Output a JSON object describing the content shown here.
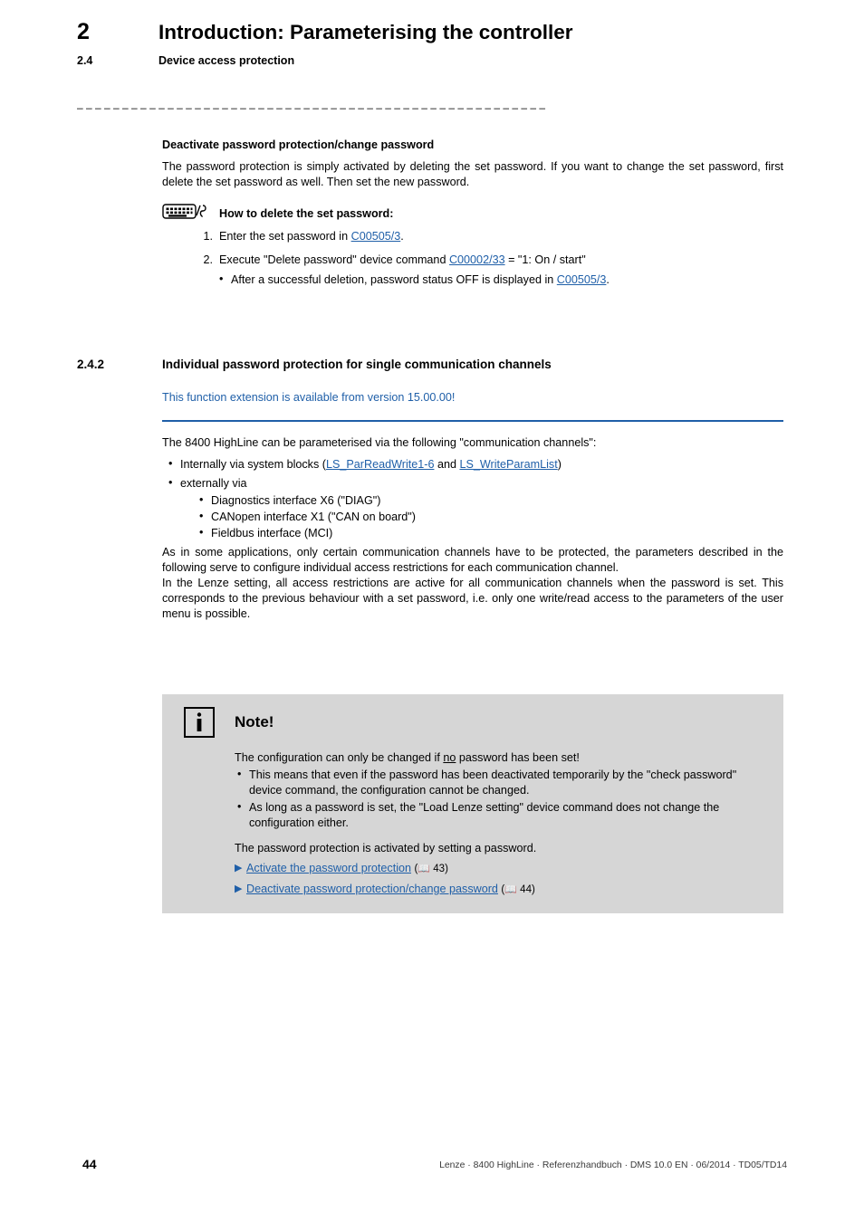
{
  "header": {
    "chapter_number": "2",
    "chapter_title": "Introduction: Parameterising the controller",
    "section_number": "2.4",
    "section_title": "Device access protection",
    "divider": "– – – – – – – – – – – – – – – – – – – – – – – – – – – – – – – – – – – – – – – – – – – – – – – – – – – –"
  },
  "block1": {
    "heading": "Deactivate password protection/change password",
    "paragraph": "The password protection is simply activated by deleting the set password. If you want to change the set password, first delete the set password as well. Then set the new password.",
    "howto_title": "How to delete the set password:",
    "step1_num": "1.",
    "step1_text_a": "Enter the set password in ",
    "step1_link": "C00505/3",
    "step1_text_b": ".",
    "step2_num": "2.",
    "step2_text_a": "Execute \"Delete password\" device command ",
    "step2_link": "C00002/33",
    "step2_text_b": " = \"1: On / start\"",
    "step2_sub_a": "After a successful deletion, password status OFF is displayed in ",
    "step2_sub_link": "C00505/3",
    "step2_sub_b": "."
  },
  "subsection": {
    "number": "2.4.2",
    "title": "Individual password protection for single communication channels",
    "version_note": "This function extension is available from version 15.00.00!"
  },
  "block2": {
    "intro": "The 8400 HighLine can be parameterised via the following \"communication channels\":",
    "bullet1_a": "Internally via system blocks (",
    "bullet1_link1": "LS_ParReadWrite1-6",
    "bullet1_mid": " and ",
    "bullet1_link2": "LS_WriteParamList",
    "bullet1_b": ")",
    "bullet2": "externally via",
    "subbullets": [
      "Diagnostics interface X6 (\"DIAG\")",
      "CANopen interface X1 (\"CAN on board\")",
      "Fieldbus interface (MCI)"
    ],
    "para1": "As in some applications, only certain communication channels have to be protected, the parameters described in the following serve to configure individual access restrictions for each communication channel.",
    "para2": "In the Lenze setting, all access restrictions are active for all communication channels when the password is set. This corresponds to the previous behaviour with a set password, i.e. only one write/read access to the parameters of the user menu is possible."
  },
  "note": {
    "icon_name": "info-icon",
    "title": "Note!",
    "line1_a": "The configuration can only be changed if ",
    "line1_underline": "no",
    "line1_b": " password has been set!",
    "bullets": [
      "This means that even if the password has been deactivated temporarily by the \"check password\" device command, the configuration cannot be changed.",
      "As long as a password is set, the \"Load Lenze setting\" device command does not change the configuration either."
    ],
    "closing": "The password protection is activated by setting a password.",
    "xrefs": [
      {
        "label": "Activate the password protection",
        "page": "43"
      },
      {
        "label": "Deactivate password protection/change password",
        "page": "44"
      }
    ]
  },
  "footer": {
    "page_number": "44",
    "text": "Lenze · 8400 HighLine · Referenzhandbuch · DMS 10.0 EN · 06/2014 · TD05/TD14"
  },
  "colors": {
    "link": "#1f5fa8",
    "note_bg": "#d6d6d6",
    "rule": "#1f5fa8"
  }
}
